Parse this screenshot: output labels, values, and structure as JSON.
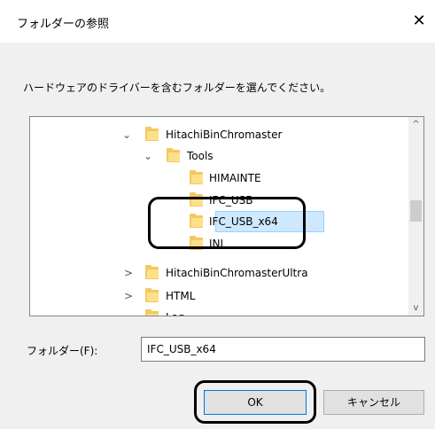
{
  "window": {
    "title": "フォルダーの参照",
    "close_label": "✕"
  },
  "instruction": "ハードウェアのドライバーを含むフォルダーを選んでください。",
  "tree": {
    "items": [
      {
        "label": "HitachiBinChromaster",
        "expanded": true
      },
      {
        "label": "Tools",
        "expanded": true
      },
      {
        "label": "HIMAINTE"
      },
      {
        "label": "IFC_USB"
      },
      {
        "label": "IFC_USB_x64",
        "selected": true
      },
      {
        "label": "INI"
      },
      {
        "label": "HitachiBinChromasterUltra",
        "expanded": false
      },
      {
        "label": "HTML",
        "expanded": false
      },
      {
        "label": "Log"
      }
    ],
    "chevron_expanded": "⌄",
    "chevron_collapsed": ">"
  },
  "scrollbar": {
    "up": "^",
    "down": "v"
  },
  "folder_field": {
    "label": "フォルダー(F):",
    "value": "IFC_USB_x64"
  },
  "buttons": {
    "ok": "OK",
    "cancel": "キャンセル"
  },
  "colors": {
    "selection": "#cde8ff",
    "folder": "#f5c863",
    "callout": "#000000"
  }
}
